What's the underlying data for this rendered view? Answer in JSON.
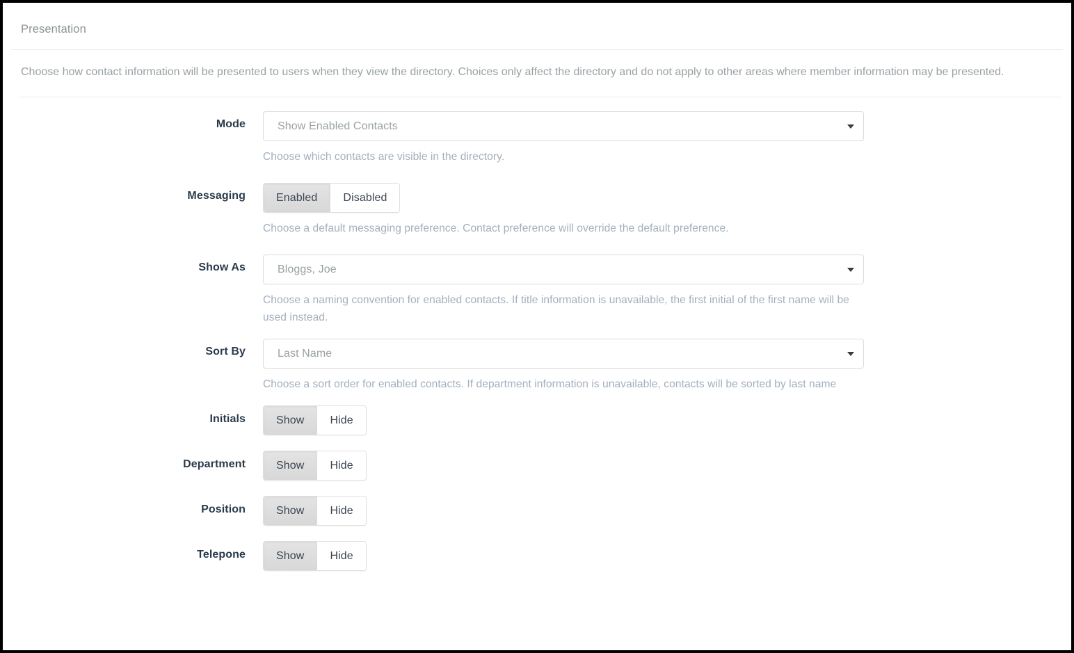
{
  "panel": {
    "title": "Presentation",
    "intro": "Choose how contact information will be presented to users when they view the directory. Choices only affect the directory and do not apply to other areas where member information may be presented."
  },
  "fields": {
    "mode": {
      "label": "Mode",
      "value": "Show Enabled Contacts",
      "help": "Choose which contacts are visible in the directory.",
      "icon": "chevron-down-icon"
    },
    "messaging": {
      "label": "Messaging",
      "options": [
        "Enabled",
        "Disabled"
      ],
      "selected": "Enabled",
      "help": "Choose a default messaging preference. Contact preference will override the default preference."
    },
    "show_as": {
      "label": "Show As",
      "value": "Bloggs, Joe",
      "help": "Choose a naming convention for enabled contacts. If title information is unavailable, the first initial of the first name will be used instead.",
      "icon": "chevron-down-icon"
    },
    "sort_by": {
      "label": "Sort By",
      "value": "Last Name",
      "help": "Choose a sort order for enabled contacts. If department information is unavailable, contacts will be sorted by last name",
      "icon": "chevron-down-icon"
    }
  },
  "toggles": [
    {
      "label": "Initials",
      "options": [
        "Show",
        "Hide"
      ],
      "selected": "Show"
    },
    {
      "label": "Department",
      "options": [
        "Show",
        "Hide"
      ],
      "selected": "Show"
    },
    {
      "label": "Position",
      "options": [
        "Show",
        "Hide"
      ],
      "selected": "Show"
    },
    {
      "label": "Telepone",
      "options": [
        "Show",
        "Hide"
      ],
      "selected": "Show"
    }
  ],
  "colors": {
    "label_text": "#2b3a4a",
    "help_text": "#a3b0bd",
    "muted_text": "#9aa1a4",
    "border": "#dcdcdc",
    "active_segment": "#dddddd"
  }
}
